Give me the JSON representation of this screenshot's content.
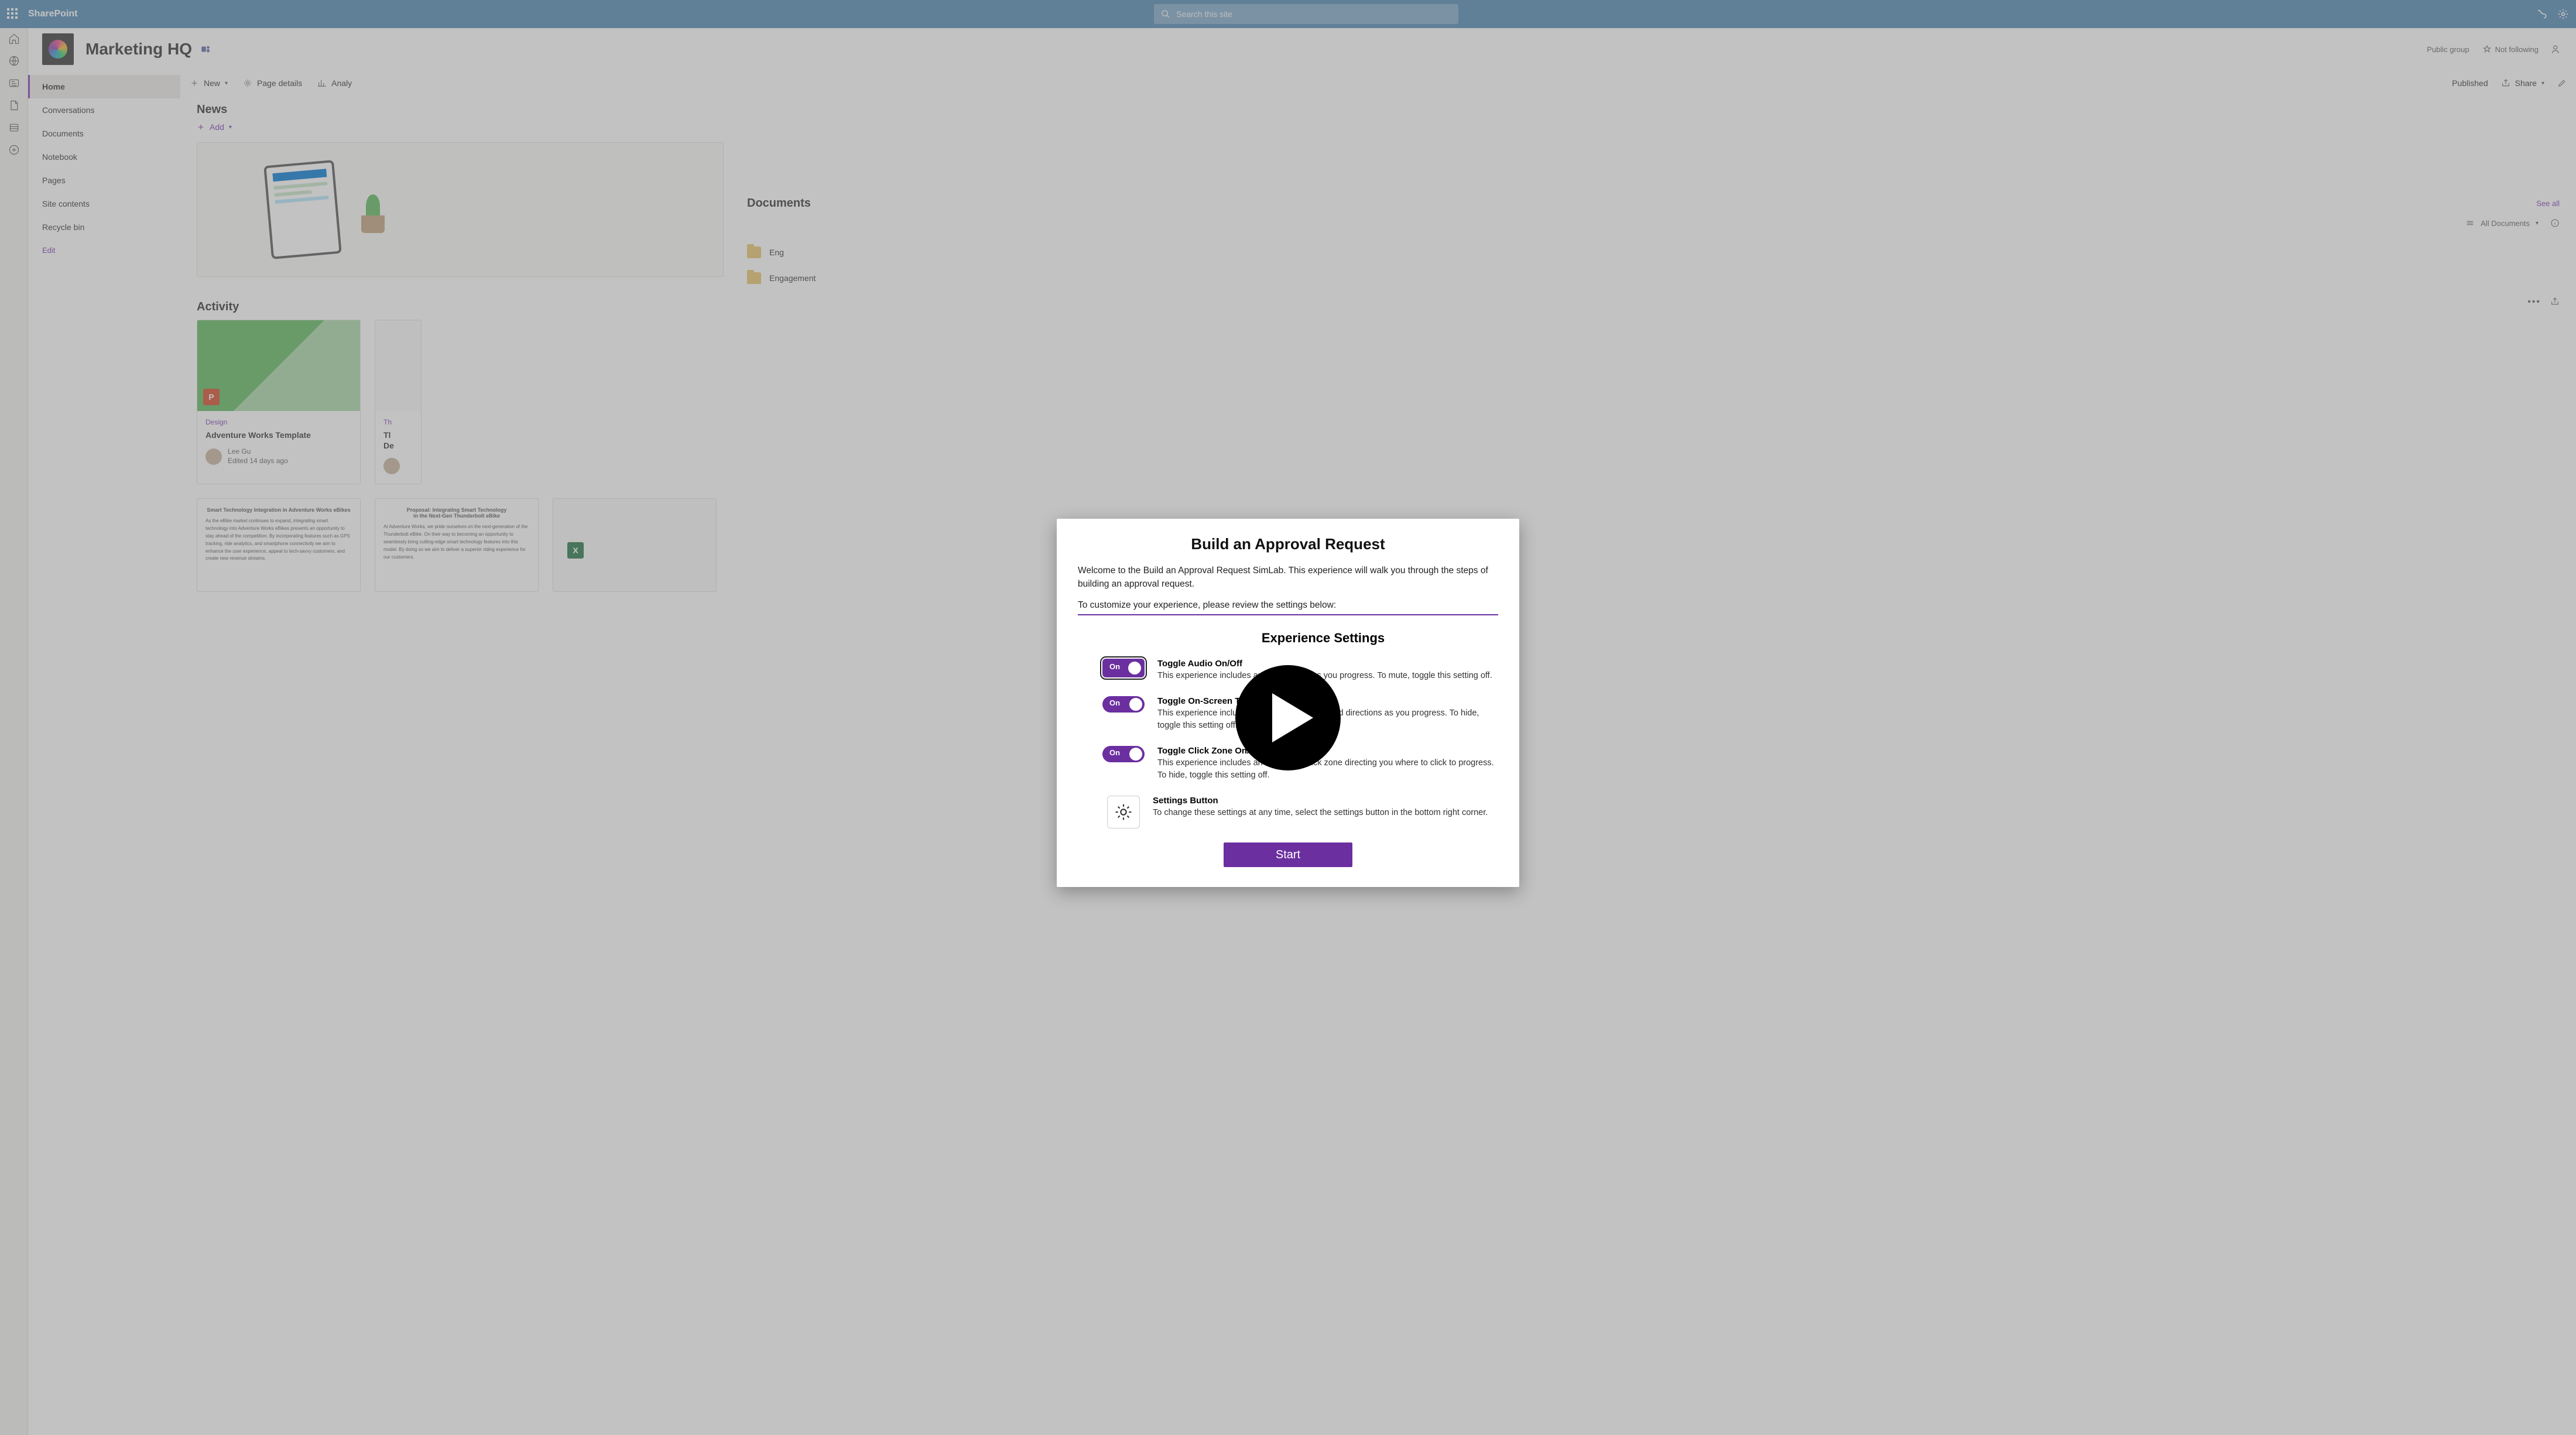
{
  "suite": {
    "brand": "SharePoint",
    "search_placeholder": "Search this site"
  },
  "site": {
    "title": "Marketing HQ",
    "group_type": "Public group",
    "follow_label": "Not following"
  },
  "nav": {
    "items": [
      "Home",
      "Conversations",
      "Documents",
      "Notebook",
      "Pages",
      "Site contents",
      "Recycle bin"
    ],
    "edit": "Edit"
  },
  "cmd": {
    "new": "New",
    "page_details": "Page details",
    "analy": "Analy",
    "published": "Published",
    "share": "Share"
  },
  "news": {
    "title": "News",
    "add": "Add"
  },
  "activity": {
    "title": "Activity",
    "card1": {
      "category": "Design",
      "title": "Adventure Works Template",
      "author": "Lee Gu",
      "when": "Edited 14 days ago"
    },
    "card2": {
      "category": "Th",
      "title_line1": "Tl",
      "title_line2": "De"
    },
    "doc1_title": "Smart Technology Integration in Adventure Works eBikes",
    "doc2_line1": "Proposal: Integrating Smart Technology",
    "doc2_line2": "in the Next-Gen Thunderbolt eBike"
  },
  "documents": {
    "section_title": "Documents",
    "seeall": "See all",
    "filter": "All Documents",
    "folders": [
      "Eng",
      "Engagement"
    ]
  },
  "modal": {
    "title": "Build an Approval Request",
    "intro": "Welcome to the Build an Approval Request SimLab. This experience will walk you through the steps of building an approval request.",
    "intro2": "To customize your experience, please review the settings below:",
    "settings_heading": "Experience Settings",
    "toggle_on": "On",
    "audio": {
      "title": "Toggle Audio On/Off",
      "desc": "This experience includes audio narration as you progress. To mute, toggle this setting off."
    },
    "onscreen": {
      "title": "Toggle On-Screen Text On/Off",
      "desc": "This experience includes on-screen narration and directions as you progress. To hide, toggle this setting off."
    },
    "clickzone": {
      "title": "Toggle Click Zone On/Off",
      "desc": "This experience includes an on-screen click zone directing you where to click to progress. To hide, toggle this setting off."
    },
    "settings_btn": {
      "title": "Settings Button",
      "desc": "To change these settings at any time, select the settings button in the bottom right corner."
    },
    "start": "Start"
  }
}
